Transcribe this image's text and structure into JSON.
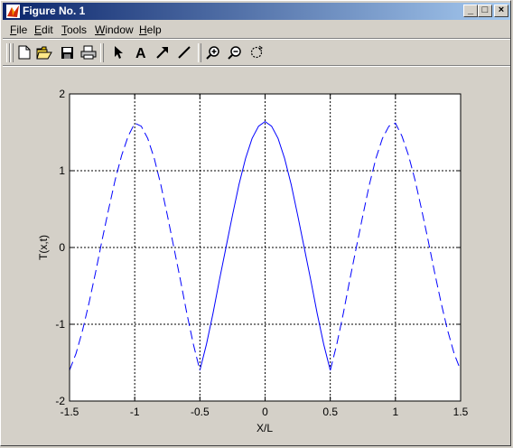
{
  "window": {
    "title": "Figure No. 1"
  },
  "title_buttons": {
    "minimize": "_",
    "maximize": "□",
    "close": "×"
  },
  "menu": [
    {
      "label": "File",
      "key": "F",
      "rest": "ile"
    },
    {
      "label": "Edit",
      "key": "E",
      "rest": "dit"
    },
    {
      "label": "Tools",
      "key": "T",
      "rest": "ools"
    },
    {
      "label": "Window",
      "key": "W",
      "rest": "indow"
    },
    {
      "label": "Help",
      "key": "H",
      "rest": "elp"
    }
  ],
  "toolbar": {
    "icons": [
      "new-file-icon",
      "open-folder-icon",
      "save-icon",
      "print-icon",
      "arrow-select-icon",
      "text-insert-icon",
      "arrow-insert-icon",
      "line-insert-icon",
      "zoom-in-icon",
      "zoom-out-icon",
      "rotate-icon"
    ],
    "text_tool_glyph": "A"
  },
  "colors": {
    "line": "#0000ff",
    "titlebar_start": "#0a246a",
    "titlebar_end": "#a6caf0",
    "face": "#d4d0c8"
  },
  "chart_data": {
    "type": "line",
    "title": "",
    "xlabel": "X/L",
    "ylabel": "T(x,t)",
    "xlim": [
      -1.5,
      1.5
    ],
    "ylim": [
      -2,
      2
    ],
    "xticks": [
      "-1.5",
      "-1",
      "-0.5",
      "0",
      "0.5",
      "1",
      "1.5"
    ],
    "yticks": [
      "-2",
      "-1",
      "0",
      "1",
      "2"
    ],
    "grid": true,
    "series": [
      {
        "style": "dashed",
        "x": [
          -1.5,
          -1.45,
          -1.4,
          -1.35,
          -1.3,
          -1.25,
          -1.2,
          -1.15,
          -1.1,
          -1.05,
          -1.0,
          -0.95,
          -0.9,
          -0.85,
          -0.8,
          -0.75,
          -0.7,
          -0.65,
          -0.6,
          -0.55,
          -0.5
        ],
        "y": [
          -1.6,
          -1.38,
          -1.08,
          -0.72,
          -0.32,
          0.1,
          0.5,
          0.88,
          1.2,
          1.45,
          1.62,
          1.58,
          1.42,
          1.16,
          0.82,
          0.42,
          0.0,
          -0.42,
          -0.86,
          -1.26,
          -1.6
        ]
      },
      {
        "style": "solid",
        "x": [
          -0.5,
          -0.45,
          -0.4,
          -0.35,
          -0.3,
          -0.25,
          -0.2,
          -0.15,
          -0.1,
          -0.05,
          0.0,
          0.05,
          0.1,
          0.15,
          0.2,
          0.25,
          0.3,
          0.35,
          0.4,
          0.45,
          0.5
        ],
        "y": [
          -1.6,
          -1.26,
          -0.86,
          -0.42,
          0.0,
          0.42,
          0.82,
          1.16,
          1.42,
          1.58,
          1.64,
          1.58,
          1.42,
          1.16,
          0.82,
          0.42,
          0.0,
          -0.42,
          -0.86,
          -1.26,
          -1.6
        ]
      },
      {
        "style": "dashed",
        "x": [
          0.5,
          0.55,
          0.6,
          0.65,
          0.7,
          0.75,
          0.8,
          0.85,
          0.9,
          0.95,
          1.0,
          1.05,
          1.1,
          1.15,
          1.2,
          1.25,
          1.3,
          1.35,
          1.4,
          1.45,
          1.5
        ],
        "y": [
          -1.6,
          -1.26,
          -0.86,
          -0.42,
          0.0,
          0.42,
          0.82,
          1.16,
          1.42,
          1.58,
          1.62,
          1.45,
          1.2,
          0.88,
          0.5,
          0.1,
          -0.32,
          -0.72,
          -1.08,
          -1.38,
          -1.6
        ]
      }
    ]
  }
}
